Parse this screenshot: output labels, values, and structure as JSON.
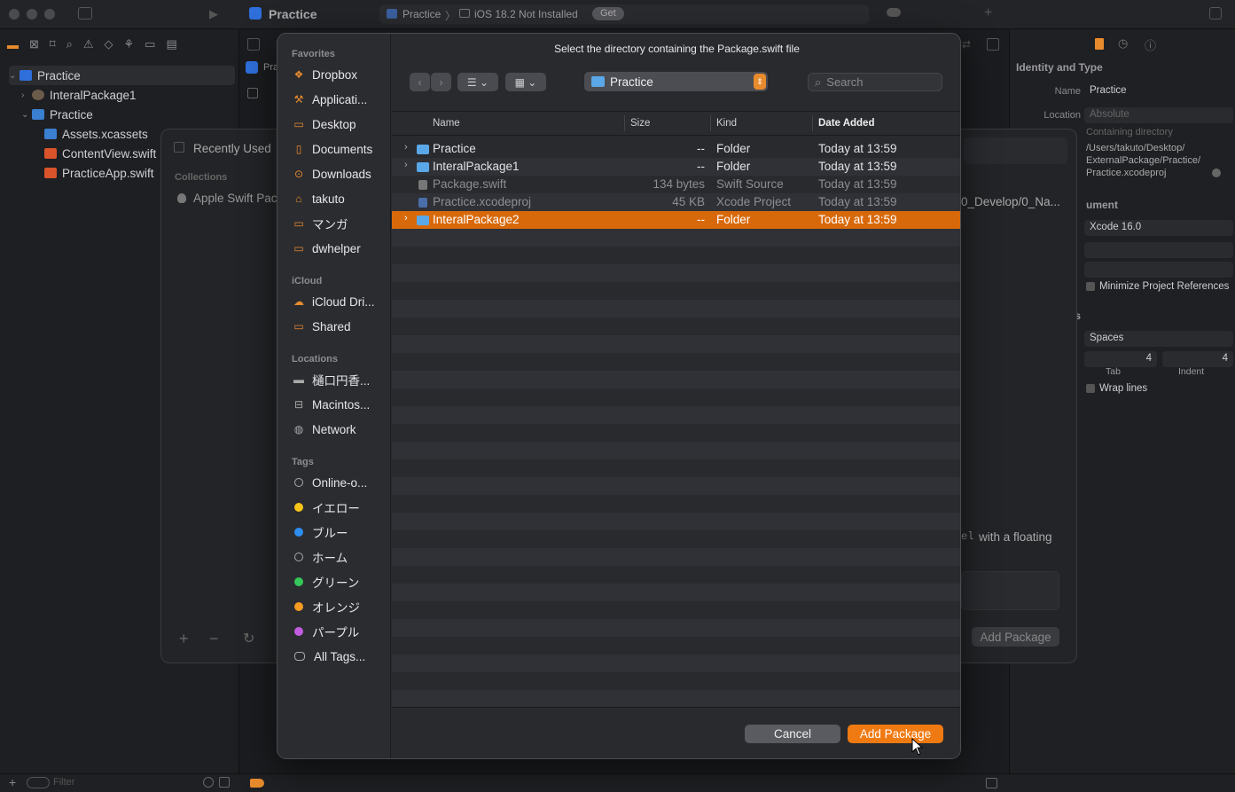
{
  "xcode": {
    "title": "Practice",
    "scheme": "Practice",
    "destination": "iOS 18.2 Not Installed",
    "get_label": "Get",
    "tab_label": "Pra",
    "tree": [
      {
        "label": "Practice",
        "type": "project"
      },
      {
        "label": "InteralPackage1",
        "type": "package"
      },
      {
        "label": "Practice",
        "type": "folder"
      },
      {
        "label": "Assets.xcassets",
        "type": "assets"
      },
      {
        "label": "ContentView.swift",
        "type": "swift"
      },
      {
        "label": "PracticeApp.swift",
        "type": "swift"
      }
    ],
    "filter_placeholder": "Filter",
    "inspector": {
      "section_identity": "Identity and Type",
      "name_label": "Name",
      "name_value": "Practice",
      "location_label": "Location",
      "location_value": "Absolute",
      "containing_label": "Containing directory",
      "path_line1": "/Users/takuto/Desktop/",
      "path_line2": "ExternalPackage/Practice/",
      "path_line3": "Practice.xcodeproj",
      "section_document": "ument",
      "xcode_version": "Xcode 16.0",
      "minimize_label": "Minimize Project References",
      "section_text": "gs",
      "indent_using": "Spaces",
      "tab_value": "4",
      "indent_value": "4",
      "tab_label": "Tab",
      "indent_label": "Indent",
      "wrap_label": "Wrap lines"
    }
  },
  "background_sheet": {
    "recently_used": "Recently Used",
    "collections": "Collections",
    "apple_packages": "Apple Swift Pac",
    "path_fragment": "0_Develop/0_Na...",
    "floating_text": "with a floating",
    "el_fragment": "el",
    "add_package": "Add Package"
  },
  "dialog": {
    "title": "Select the directory containing the Package.swift file",
    "current_folder": "Practice",
    "search_placeholder": "Search",
    "sidebar": {
      "favorites_header": "Favorites",
      "favorites": [
        {
          "label": "Dropbox",
          "icon": "dropbox-icon"
        },
        {
          "label": "Applicati...",
          "icon": "applications-icon"
        },
        {
          "label": "Desktop",
          "icon": "desktop-icon"
        },
        {
          "label": "Documents",
          "icon": "documents-icon"
        },
        {
          "label": "Downloads",
          "icon": "downloads-icon"
        },
        {
          "label": "takuto",
          "icon": "home-icon"
        },
        {
          "label": "マンガ",
          "icon": "folder-icon"
        },
        {
          "label": "dwhelper",
          "icon": "folder-icon"
        }
      ],
      "icloud_header": "iCloud",
      "icloud": [
        {
          "label": "iCloud Dri...",
          "icon": "icloud-icon"
        },
        {
          "label": "Shared",
          "icon": "shared-folder-icon"
        }
      ],
      "locations_header": "Locations",
      "locations": [
        {
          "label": "樋口円香...",
          "icon": "drive-icon"
        },
        {
          "label": "Macintos...",
          "icon": "disk-icon"
        },
        {
          "label": "Network",
          "icon": "network-icon"
        }
      ],
      "tags_header": "Tags",
      "tags": [
        {
          "label": "Online-o...",
          "color": ""
        },
        {
          "label": "イエロー",
          "color": "#f5c518"
        },
        {
          "label": "ブルー",
          "color": "#2d8ef0"
        },
        {
          "label": "ホーム",
          "color": ""
        },
        {
          "label": "グリーン",
          "color": "#34c759"
        },
        {
          "label": "オレンジ",
          "color": "#f59a23"
        },
        {
          "label": "パープル",
          "color": "#c35de0"
        },
        {
          "label": "All Tags...",
          "color": "all"
        }
      ]
    },
    "columns": {
      "name": "Name",
      "size": "Size",
      "kind": "Kind",
      "date": "Date Added"
    },
    "files": [
      {
        "name": "Practice",
        "size": "--",
        "kind": "Folder",
        "date": "Today at 13:59",
        "folder": true,
        "enabled": true,
        "selected": false
      },
      {
        "name": "InteralPackage1",
        "size": "--",
        "kind": "Folder",
        "date": "Today at 13:59",
        "folder": true,
        "enabled": true,
        "selected": false
      },
      {
        "name": "Package.swift",
        "size": "134 bytes",
        "kind": "Swift Source",
        "date": "Today at 13:59",
        "folder": false,
        "enabled": false,
        "selected": false
      },
      {
        "name": "Practice.xcodeproj",
        "size": "45 KB",
        "kind": "Xcode Project",
        "date": "Today at 13:59",
        "folder": false,
        "enabled": false,
        "selected": false
      },
      {
        "name": "InteralPackage2",
        "size": "--",
        "kind": "Folder",
        "date": "Today at 13:59",
        "folder": true,
        "enabled": true,
        "selected": true
      }
    ],
    "cancel_label": "Cancel",
    "add_label": "Add Package",
    "accent": "#f07a12",
    "selection_color": "#d8690a"
  }
}
